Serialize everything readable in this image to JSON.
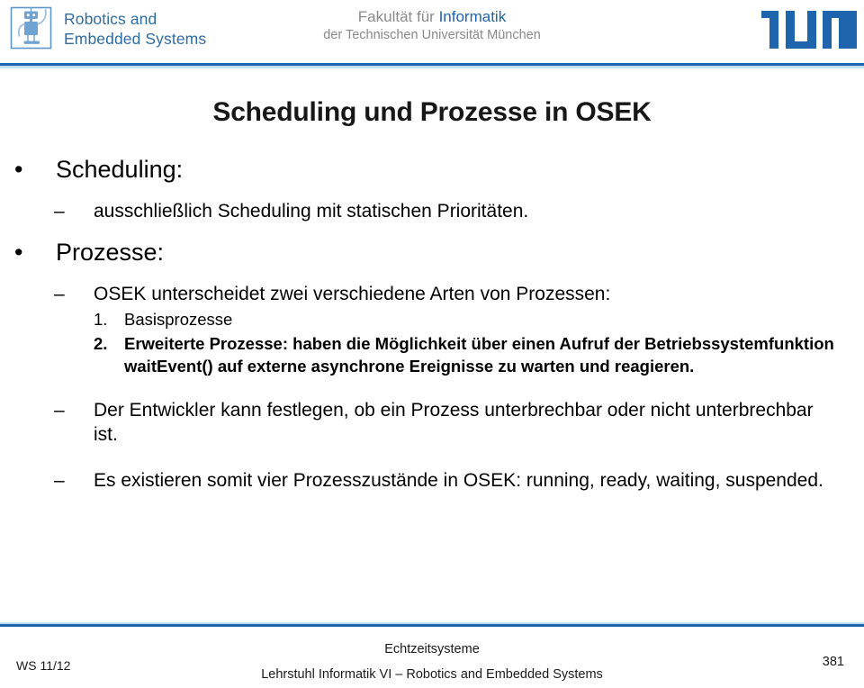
{
  "header": {
    "lab_logo": {
      "icon": "robot-in-square-icon",
      "line1": "Robotics and",
      "line2": "Embedded Systems",
      "color": "#2e6ca4"
    },
    "faculty": {
      "line1_prefix": "Fakultät für ",
      "line1_highlight": "Informatik",
      "line2": "der Technischen Universität München",
      "text_color": "#8a8a8a",
      "highlight_color": "#1d63ad"
    },
    "university_logo": {
      "icon": "tum-logo-icon",
      "alt": "TUM",
      "color": "#1f65ad"
    },
    "rule_dark_color": "#1f65ad",
    "rule_light_color": "#bfe0f5"
  },
  "slide": {
    "title": "Scheduling und Prozesse in OSEK",
    "blocks": [
      {
        "level": 1,
        "marker": "•",
        "text": "Scheduling:"
      },
      {
        "level": 2,
        "marker": "–",
        "text": "ausschließlich Scheduling mit statischen Prioritäten."
      },
      {
        "level": 1,
        "marker": "•",
        "text": "Prozesse:"
      },
      {
        "level": 2,
        "marker": "–",
        "text": "OSEK unterscheidet zwei verschiedene Arten von Prozessen:"
      },
      {
        "level": 3,
        "marker": "1.",
        "text": "Basisprozesse",
        "bold": false
      },
      {
        "level": 3,
        "marker": "2.",
        "text": "Erweiterte Prozesse: haben die Möglichkeit über einen Aufruf der Betriebssystemfunktion waitEvent() auf externe asynchrone Ereignisse zu warten und reagieren.",
        "bold": true
      },
      {
        "level": 2,
        "marker": "–",
        "text": "Der Entwickler kann festlegen, ob ein Prozess unterbrechbar oder nicht unterbrechbar ist."
      },
      {
        "level": 2,
        "marker": "–",
        "text": "Es existieren somit vier Prozesszustände in OSEK: running, ready, waiting, suspended."
      }
    ]
  },
  "footer": {
    "term": "WS 11/12",
    "course": "Echtzeitsysteme",
    "chair": "Lehrstuhl Informatik VI – Robotics and Embedded Systems",
    "page_number": "381"
  }
}
